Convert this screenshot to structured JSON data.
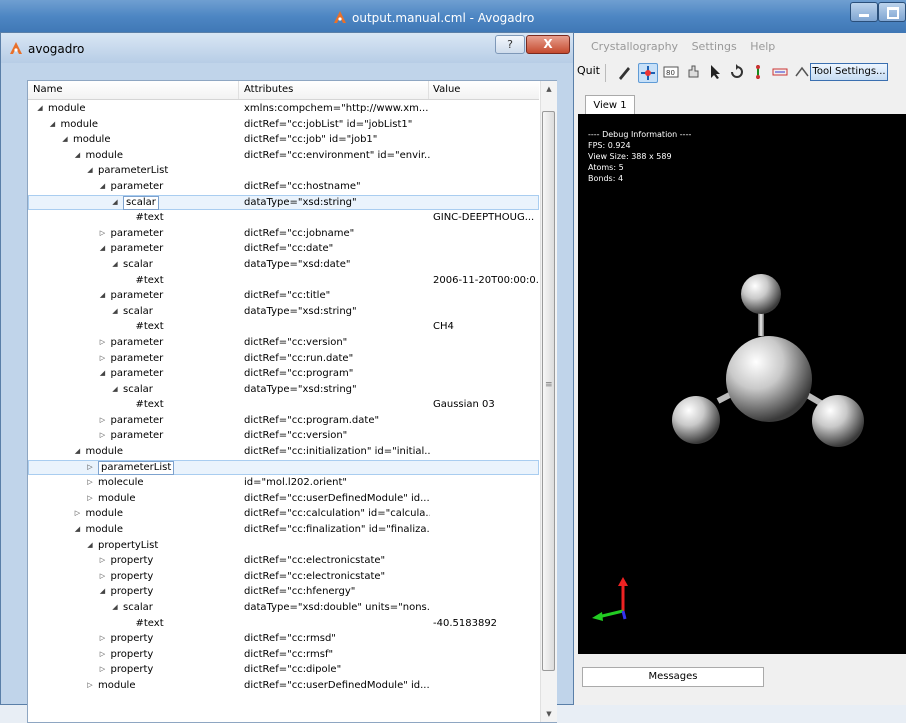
{
  "main_window": {
    "title": "output.manual.cml - Avogadro",
    "menu": [
      "Crystallography",
      "Settings",
      "Help"
    ],
    "toolbar": {
      "quit_label": "Quit",
      "tool_icons": [
        "draw-icon",
        "navigate-icon",
        "measure-icon",
        "manipulate-icon",
        "select-icon",
        "rotate-icon",
        "align-icon",
        "bond-centric-icon",
        "symmetry-icon"
      ],
      "tool_settings_label": "Tool Settings..."
    },
    "view_tab": "View 1",
    "debug_info": [
      "---- Debug Information ----",
      "FPS: 0.924",
      "View Size: 388 x 589",
      "Atoms: 5",
      "Bonds: 4"
    ],
    "messages_tab": "Messages"
  },
  "dialog": {
    "title": "avogadro",
    "help_label": "?",
    "close_label": "X",
    "columns": [
      "Name",
      "Attributes",
      "Value"
    ],
    "rows": [
      {
        "name": "module",
        "indent": 0,
        "state": "open",
        "attrs": "xmlns:compchem=\"http://www.xm...",
        "value": ""
      },
      {
        "name": "module",
        "indent": 1,
        "state": "open",
        "attrs": "dictRef=\"cc:jobList\" id=\"jobList1\"",
        "value": ""
      },
      {
        "name": "module",
        "indent": 2,
        "state": "open",
        "attrs": "dictRef=\"cc:job\" id=\"job1\"",
        "value": ""
      },
      {
        "name": "module",
        "indent": 3,
        "state": "open",
        "attrs": "dictRef=\"cc:environment\" id=\"envir...",
        "value": ""
      },
      {
        "name": "parameterList",
        "indent": 4,
        "state": "open",
        "attrs": "",
        "value": ""
      },
      {
        "name": "parameter",
        "indent": 5,
        "state": "open",
        "attrs": "dictRef=\"cc:hostname\"",
        "value": ""
      },
      {
        "name": "scalar",
        "indent": 6,
        "state": "open",
        "attrs": "dataType=\"xsd:string\"",
        "value": "",
        "selected": true
      },
      {
        "name": "#text",
        "indent": 7,
        "state": "leaf",
        "attrs": "",
        "value": "GINC-DEEPTHOUG..."
      },
      {
        "name": "parameter",
        "indent": 5,
        "state": "closed",
        "attrs": "dictRef=\"cc:jobname\"",
        "value": ""
      },
      {
        "name": "parameter",
        "indent": 5,
        "state": "open",
        "attrs": "dictRef=\"cc:date\"",
        "value": ""
      },
      {
        "name": "scalar",
        "indent": 6,
        "state": "open",
        "attrs": "dataType=\"xsd:date\"",
        "value": ""
      },
      {
        "name": "#text",
        "indent": 7,
        "state": "leaf",
        "attrs": "",
        "value": "2006-11-20T00:00:0..."
      },
      {
        "name": "parameter",
        "indent": 5,
        "state": "open",
        "attrs": "dictRef=\"cc:title\"",
        "value": ""
      },
      {
        "name": "scalar",
        "indent": 6,
        "state": "open",
        "attrs": "dataType=\"xsd:string\"",
        "value": ""
      },
      {
        "name": "#text",
        "indent": 7,
        "state": "leaf",
        "attrs": "",
        "value": "CH4"
      },
      {
        "name": "parameter",
        "indent": 5,
        "state": "closed",
        "attrs": "dictRef=\"cc:version\"",
        "value": ""
      },
      {
        "name": "parameter",
        "indent": 5,
        "state": "closed",
        "attrs": "dictRef=\"cc:run.date\"",
        "value": ""
      },
      {
        "name": "parameter",
        "indent": 5,
        "state": "open",
        "attrs": "dictRef=\"cc:program\"",
        "value": ""
      },
      {
        "name": "scalar",
        "indent": 6,
        "state": "open",
        "attrs": "dataType=\"xsd:string\"",
        "value": ""
      },
      {
        "name": "#text",
        "indent": 7,
        "state": "leaf",
        "attrs": "",
        "value": "Gaussian 03"
      },
      {
        "name": "parameter",
        "indent": 5,
        "state": "closed",
        "attrs": "dictRef=\"cc:program.date\"",
        "value": ""
      },
      {
        "name": "parameter",
        "indent": 5,
        "state": "closed",
        "attrs": "dictRef=\"cc:version\"",
        "value": ""
      },
      {
        "name": "module",
        "indent": 3,
        "state": "open",
        "attrs": "dictRef=\"cc:initialization\" id=\"initial...",
        "value": ""
      },
      {
        "name": "parameterList",
        "indent": 4,
        "state": "closed",
        "attrs": "",
        "value": "",
        "selected": true
      },
      {
        "name": "molecule",
        "indent": 4,
        "state": "closed",
        "attrs": "id=\"mol.l202.orient\"",
        "value": ""
      },
      {
        "name": "module",
        "indent": 4,
        "state": "closed",
        "attrs": "dictRef=\"cc:userDefinedModule\" id...",
        "value": ""
      },
      {
        "name": "module",
        "indent": 3,
        "state": "closed",
        "attrs": "dictRef=\"cc:calculation\" id=\"calcula...",
        "value": ""
      },
      {
        "name": "module",
        "indent": 3,
        "state": "open",
        "attrs": "dictRef=\"cc:finalization\" id=\"finaliza...",
        "value": ""
      },
      {
        "name": "propertyList",
        "indent": 4,
        "state": "open",
        "attrs": "",
        "value": ""
      },
      {
        "name": "property",
        "indent": 5,
        "state": "closed",
        "attrs": "dictRef=\"cc:electronicstate\"",
        "value": ""
      },
      {
        "name": "property",
        "indent": 5,
        "state": "closed",
        "attrs": "dictRef=\"cc:electronicstate\"",
        "value": ""
      },
      {
        "name": "property",
        "indent": 5,
        "state": "open",
        "attrs": "dictRef=\"cc:hfenergy\"",
        "value": ""
      },
      {
        "name": "scalar",
        "indent": 6,
        "state": "open",
        "attrs": "dataType=\"xsd:double\" units=\"nons...",
        "value": ""
      },
      {
        "name": "#text",
        "indent": 7,
        "state": "leaf",
        "attrs": "",
        "value": "-40.5183892"
      },
      {
        "name": "property",
        "indent": 5,
        "state": "closed",
        "attrs": "dictRef=\"cc:rmsd\"",
        "value": ""
      },
      {
        "name": "property",
        "indent": 5,
        "state": "closed",
        "attrs": "dictRef=\"cc:rmsf\"",
        "value": ""
      },
      {
        "name": "property",
        "indent": 5,
        "state": "closed",
        "attrs": "dictRef=\"cc:dipole\"",
        "value": ""
      },
      {
        "name": "module",
        "indent": 4,
        "state": "closed",
        "attrs": "dictRef=\"cc:userDefinedModule\" id...",
        "value": ""
      }
    ]
  },
  "colors": {
    "titlebar": "#4d86c3",
    "viewport_bg": "#000000",
    "selection": "#eaf3fc",
    "close_button": "#c44a2f"
  }
}
